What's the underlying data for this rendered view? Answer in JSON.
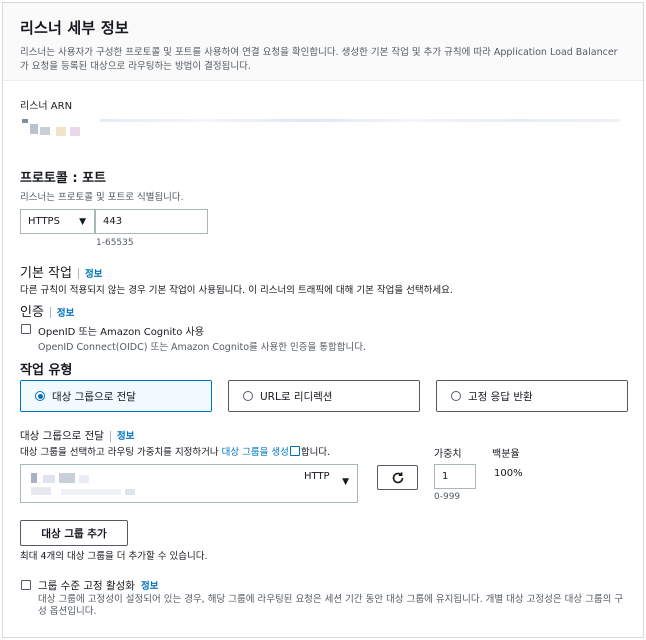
{
  "header": {
    "title": "리스너 세부 정보",
    "description": "리스너는 사용자가 구성한 프로토콜 및 포트를 사용하여 연결 요청을 확인합니다. 생성한 기본 작업 및 추가 규칙에 따라 Application Load Balancer가 요청을 등록된 대상으로 라우팅하는 방법이 결정됩니다."
  },
  "arn": {
    "label": "리스너 ARN"
  },
  "protocol_port": {
    "title": "프로토콜 : 포트",
    "description": "리스너는 프로토콜 및 포트로 식별됩니다.",
    "protocol_value": "HTTPS",
    "port_value": "443",
    "port_hint": "1-65535"
  },
  "default_action": {
    "title": "기본 작업",
    "info": "정보",
    "description": "다른 규칙이 적용되지 않는 경우 기본 작업이 사용됩니다. 이 리스너의 트래픽에 대해 기본 작업을 선택하세요."
  },
  "auth": {
    "title": "인증",
    "info": "정보",
    "checkbox_label": "OpenID 또는 Amazon Cognito 사용",
    "checkbox_desc": "OpenID Connect(OIDC) 또는 Amazon Cognito를 사용한 인증을 통합합니다."
  },
  "action_type": {
    "title": "작업 유형",
    "options": [
      "대상 그룹으로 전달",
      "URL로 리디렉션",
      "고정 응답 반환"
    ],
    "selected_index": 0
  },
  "forward": {
    "title": "대상 그룹으로 전달",
    "info": "정보",
    "desc_prefix": "대상 그룹을 선택하고 라우팅 가중치를 지정하거나 ",
    "desc_link": "대상 그룹을 생성",
    "desc_suffix": "합니다.",
    "weight_label": "가중치",
    "percent_label": "백분율",
    "target_type": "HTTP",
    "weight_value": "1",
    "weight_hint": "0-999",
    "percent_value": "100%"
  },
  "add_group": {
    "button_label": "대상 그룹 추가",
    "hint": "최대 4개의 대상 그룹을 더 추가할 수 있습니다."
  },
  "stickiness": {
    "checkbox_label": "그룹 수준 고정 활성화",
    "info": "정보",
    "description": "대상 그룹에 고정성이 설정되어 있는 경우, 해당 그룹에 라우팅된 요청은 세션 기간 동안 대상 그룹에 유지됩니다. 개별 대상 고정성은 대상 그룹의 구성 옵션입니다."
  },
  "colors": {
    "accent": "#0073bb",
    "border": "#aab7b8",
    "text": "#16191f",
    "muted": "#545b64"
  },
  "icons": {
    "caret": "caret-down-icon",
    "refresh": "refresh-icon",
    "external": "external-link-icon"
  }
}
